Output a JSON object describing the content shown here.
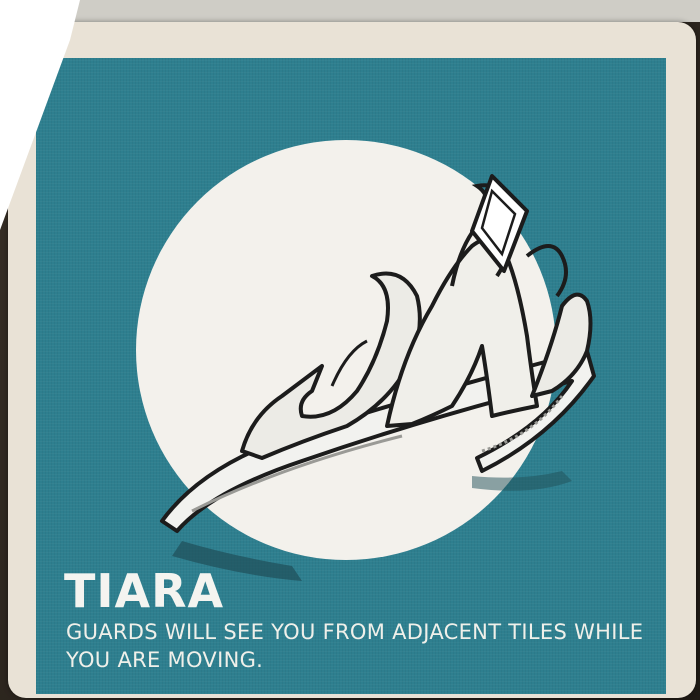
{
  "card": {
    "name": "Tiara",
    "title": "TIARA",
    "description": "GUARDS WILL SEE YOU FROM ADJACENT TILES WHILE YOU ARE MOVING.",
    "illustration": "tiara-icon"
  },
  "colors": {
    "panel": "#2e7f8f",
    "card_border": "#e9e2d6",
    "moon": "#f3f1ec",
    "text": "#f4f4f0"
  }
}
